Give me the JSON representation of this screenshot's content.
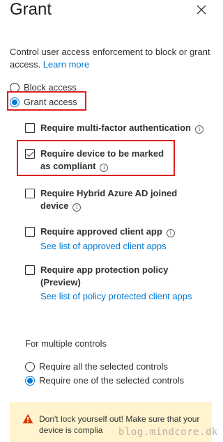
{
  "header": {
    "title": "Grant"
  },
  "description": {
    "text": "Control user access enforcement to block or grant access.",
    "learn_more": "Learn more"
  },
  "access": {
    "block_label": "Block access",
    "grant_label": "Grant access",
    "selected": "grant"
  },
  "controls": [
    {
      "label": "Require multi-factor authentication",
      "checked": false
    },
    {
      "label": "Require device to be marked as compliant",
      "checked": true
    },
    {
      "label": "Require Hybrid Azure AD joined device",
      "checked": false
    },
    {
      "label": "Require approved client app",
      "checked": false,
      "link": "See list of approved client apps"
    },
    {
      "label": "Require app protection policy (Preview)",
      "checked": false,
      "link": "See list of policy protected client apps"
    }
  ],
  "multiple": {
    "label": "For multiple controls",
    "options": [
      "Require all the selected controls",
      "Require one of the selected controls"
    ],
    "selected_index": 1
  },
  "warning": {
    "text": "Don't lock yourself out! Make sure that your device is complia"
  },
  "watermark": "blog.mindcore.dk",
  "colors": {
    "accent": "#0078d4",
    "highlight": "#e02020",
    "warning_bg": "#fff4ce",
    "warning_icon": "#d83b01"
  },
  "icons": {
    "close": "close-icon",
    "info": "info-icon",
    "warning": "warning-icon"
  }
}
